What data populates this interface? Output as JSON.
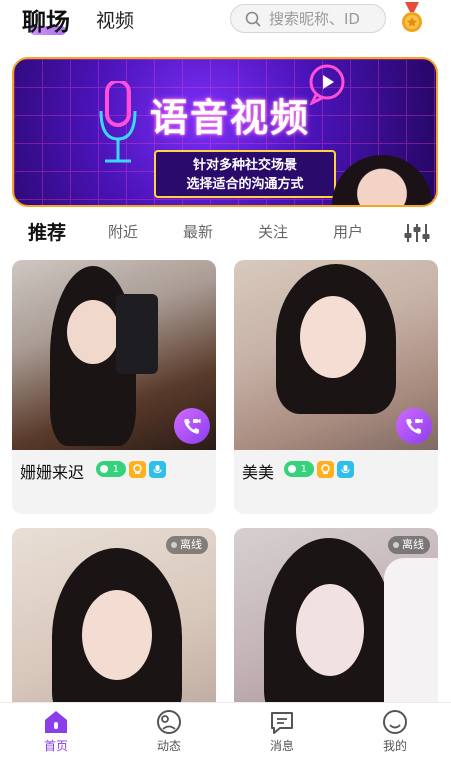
{
  "header": {
    "tab_active": "聊场",
    "tab_other": "视频",
    "search_placeholder": "搜索昵称、ID",
    "medal_icon": "medal-icon"
  },
  "banner": {
    "title": "语音视频",
    "line1": "针对多种社交场景",
    "line2": "选择适合的沟通方式"
  },
  "filters": {
    "items": [
      "推荐",
      "附近",
      "最新",
      "关注",
      "用户"
    ],
    "active": "推荐",
    "settings_icon": "filter-sliders-icon"
  },
  "cards": [
    {
      "name": "姗姗来迟",
      "level": "1",
      "online": true,
      "call_icon": "video-call-icon"
    },
    {
      "name": "美美",
      "level": "1",
      "online": true,
      "call_icon": "video-call-icon"
    },
    {
      "status": "离线",
      "online": false
    },
    {
      "status": "离线",
      "online": false
    }
  ],
  "bottom_nav": [
    {
      "label": "首页",
      "icon": "home-icon",
      "active": true
    },
    {
      "label": "动态",
      "icon": "moments-icon",
      "active": false
    },
    {
      "label": "消息",
      "icon": "message-icon",
      "active": false
    },
    {
      "label": "我的",
      "icon": "profile-icon",
      "active": false
    }
  ],
  "colors": {
    "accent": "#8a3de8",
    "banner_border": "#f5a524",
    "level_badge": "#34d27a"
  }
}
